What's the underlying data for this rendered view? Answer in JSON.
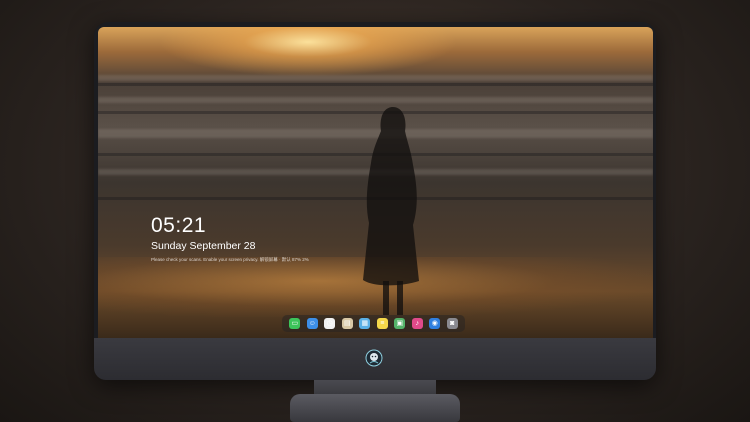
{
  "lock_screen": {
    "time": "05:21",
    "date": "Sunday September  28",
    "message": "Please check your scans. Enable your screen privacy. 解锁屏幕 · 默认 87% 2%"
  },
  "dock": {
    "items": [
      {
        "name": "messages-icon",
        "color": "#3cc45a",
        "glyph": "▭"
      },
      {
        "name": "finder-icon",
        "color": "#3d8fe8",
        "glyph": "☺"
      },
      {
        "name": "clock-icon",
        "color": "#f2f2f2",
        "glyph": "◷"
      },
      {
        "name": "contacts-icon",
        "color": "#d9c8a6",
        "glyph": "▤"
      },
      {
        "name": "claquette-icon",
        "color": "#5ab0e6",
        "glyph": "▦"
      },
      {
        "name": "notes-icon",
        "color": "#f5d84a",
        "glyph": "≡"
      },
      {
        "name": "photos-icon",
        "color": "#55b36a",
        "glyph": "▣"
      },
      {
        "name": "music-icon",
        "color": "#e04a8a",
        "glyph": "♪"
      },
      {
        "name": "safari-icon",
        "color": "#2f7fe0",
        "glyph": "◉"
      },
      {
        "name": "camera-icon",
        "color": "#8a8a90",
        "glyph": "◙"
      }
    ]
  },
  "colors": {
    "sky_glow": "#f0c070",
    "sea": "#4a4038",
    "bezel": "#1b1c20",
    "chin": "#34343a"
  }
}
